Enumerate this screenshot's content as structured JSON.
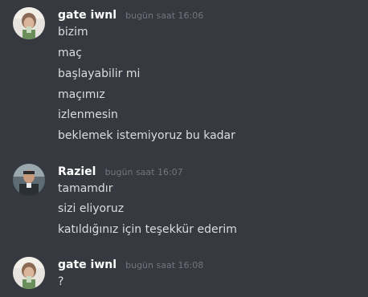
{
  "messages": [
    {
      "username": "gate iwnl",
      "timestamp": "bugün saat 16:06",
      "lines": [
        "bizim",
        "maç",
        "başlayabilir mi",
        "maçımız",
        "izlenmesin",
        "beklemek istemiyoruz bu kadar"
      ]
    },
    {
      "username": "Raziel",
      "timestamp": "bugün saat 16:07",
      "lines": [
        "tamamdır",
        "sizi eliyoruz",
        "katıldığınız için teşekkür ederim"
      ]
    },
    {
      "username": "gate iwnl",
      "timestamp": "bugün saat 16:08",
      "lines": [
        "?"
      ]
    }
  ],
  "colors": {
    "background": "#36393f",
    "username": "#ffffff",
    "timestamp": "#72767d",
    "text": "#dcddde"
  }
}
